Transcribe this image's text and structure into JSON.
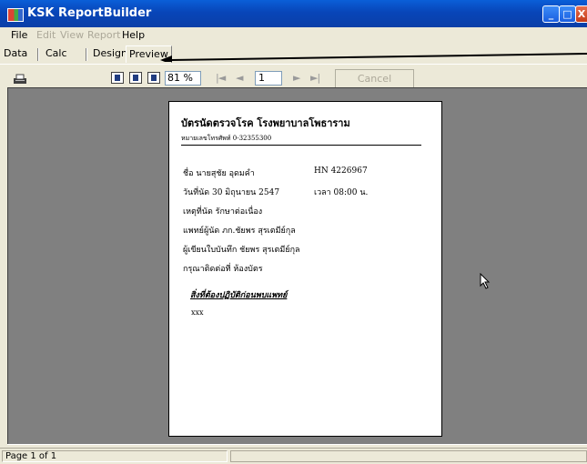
{
  "window": {
    "title": "KSK ReportBuilder"
  },
  "menu": [
    {
      "label": "File",
      "enabled": true
    },
    {
      "label": "Edit",
      "enabled": false
    },
    {
      "label": "View",
      "enabled": false
    },
    {
      "label": "Report",
      "enabled": false
    },
    {
      "label": "Help",
      "enabled": true
    }
  ],
  "tabs": [
    "Data",
    "Calc",
    "Design",
    "Preview"
  ],
  "active_tab": "Preview",
  "toolbar": {
    "zoom": "81 %",
    "first_icon": "|◄",
    "prev_icon": "◄",
    "page": "1",
    "next_icon": "►",
    "last_icon": "►|",
    "cancel": "Cancel"
  },
  "report": {
    "title": "บัตรนัดตรวจโรค โรงพยาบาลโพธาราม",
    "phone": "หมายเลขโทรศัพท์ 0-32355300",
    "name": "ชื่อ นายสุชัย อุดมคำ",
    "hn": "HN 4226967",
    "date": "วันที่นัด   30 มิถุนายน 2547",
    "time": "เวลา   08:00 น.",
    "reason": "เหตุที่นัด  รักษาต่อเนื่อง",
    "doctor": "แพทย์ผู้นัด  ภก.ชัยพร สุรเตมีย์กุล",
    "recorder": "ผู้เขียนใบบันทึก ชัยพร สุรเตมีย์กุล",
    "contact": "กรุณาติดต่อที่   ห้องบัตร",
    "note_heading": "สิ่งที่ต้องปฏิบัติก่อนพบแพทย์",
    "note_body": "xxx"
  },
  "status": {
    "page": "Page 1 of 1"
  },
  "colors": {
    "titlebar": "#0a5fd8",
    "workspace": "#808080",
    "chrome": "#ece9d8"
  }
}
